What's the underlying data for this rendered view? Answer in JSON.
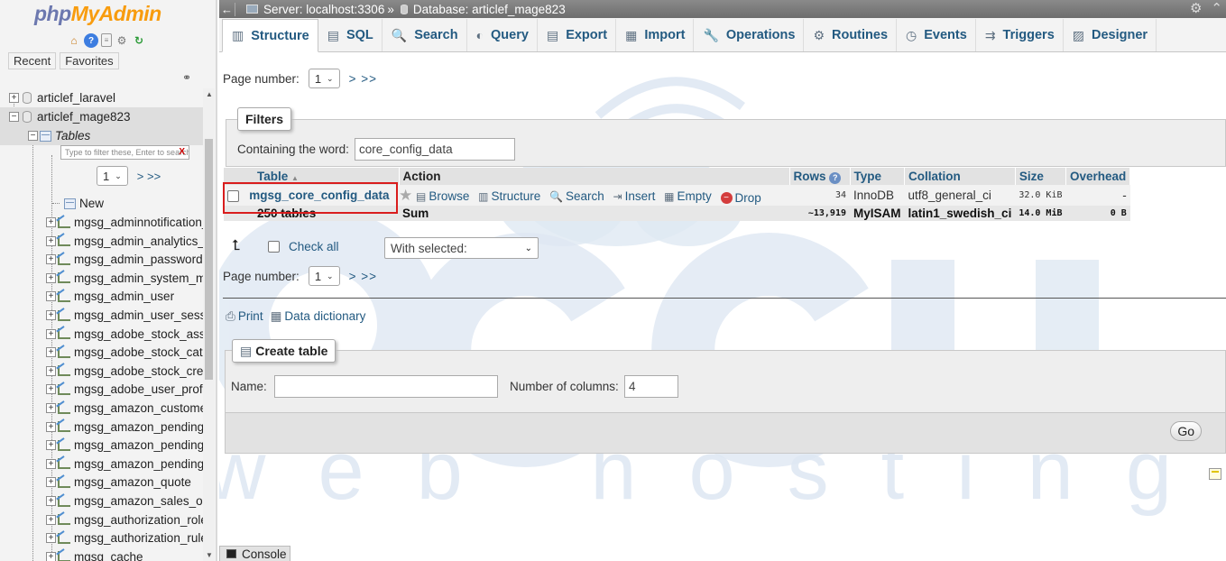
{
  "nav": {
    "logo_a": "php",
    "logo_b": "MyAdmin",
    "recent": "Recent",
    "favorites": "Favorites",
    "db1": "articlef_laravel",
    "db2": "articlef_mage823",
    "tables_label": "Tables",
    "filter_placeholder": "Type to filter these, Enter to search all",
    "filter_clear": "X",
    "page_value": "1",
    "page_next": "> >>",
    "new_label": "New",
    "tables": [
      "mgsg_adminnotification_inbox",
      "mgsg_admin_analytics_usage_version_log",
      "mgsg_admin_passwords",
      "mgsg_admin_system_messages",
      "mgsg_admin_user",
      "mgsg_admin_user_session",
      "mgsg_adobe_stock_asset",
      "mgsg_adobe_stock_category",
      "mgsg_adobe_stock_creator",
      "mgsg_adobe_user_profile",
      "mgsg_amazon_customer",
      "mgsg_amazon_pending_authorization",
      "mgsg_amazon_pending_capture",
      "mgsg_amazon_pending_refund",
      "mgsg_amazon_quote",
      "mgsg_amazon_sales_order",
      "mgsg_authorization_role",
      "mgsg_authorization_rule",
      "mgsg_cache"
    ]
  },
  "topbar": {
    "back": "←",
    "server": "Server: localhost:3306",
    "sep": "»",
    "database": "Database: articlef_mage823",
    "gear": "⚙",
    "collapse": "⌃"
  },
  "menu": {
    "tabs": [
      {
        "label": "Structure",
        "icon": "▥"
      },
      {
        "label": "SQL",
        "icon": "▤"
      },
      {
        "label": "Search",
        "icon": "🔍"
      },
      {
        "label": "Query",
        "icon": "◐"
      },
      {
        "label": "Export",
        "icon": "▤"
      },
      {
        "label": "Import",
        "icon": "▦"
      },
      {
        "label": "Operations",
        "icon": "🔧"
      },
      {
        "label": "Routines",
        "icon": "⚙"
      },
      {
        "label": "Events",
        "icon": "◷"
      },
      {
        "label": "Triggers",
        "icon": "⇉"
      },
      {
        "label": "Designer",
        "icon": "▨"
      }
    ]
  },
  "main": {
    "page_label": "Page number:",
    "page_value": "1",
    "page_next": "> >>",
    "filters_legend": "Filters",
    "containing_label": "Containing the word:",
    "containing_value": "core_config_data",
    "headers": {
      "table": "Table",
      "sort": "▲",
      "action": "Action",
      "rows": "Rows",
      "rows_help": "?",
      "type": "Type",
      "collation": "Collation",
      "size": "Size",
      "overhead": "Overhead"
    },
    "row": {
      "name": "mgsg_core_config_data",
      "browse": "Browse",
      "structure": "Structure",
      "search": "Search",
      "insert": "Insert",
      "empty": "Empty",
      "drop": "Drop",
      "rows": "34",
      "type": "InnoDB",
      "collation": "utf8_general_ci",
      "size": "32.0 KiB",
      "overhead": "-"
    },
    "sum": {
      "tables": "250 tables",
      "label": "Sum",
      "rows": "~13,919",
      "type": "MyISAM",
      "collation": "latin1_swedish_ci",
      "size": "14.0 MiB",
      "overhead": "0 B"
    },
    "check_all": "Check all",
    "with_selected": "With selected:",
    "print": "Print",
    "data_dictionary": "Data dictionary",
    "create_legend": "Create table",
    "name_label": "Name:",
    "name_value": "",
    "columns_label": "Number of columns:",
    "columns_value": "4",
    "go": "Go",
    "console": "Console"
  },
  "watermark": {
    "brand": "accu",
    "tagline": "web hosting",
    "color": "#dfe8f3"
  },
  "colors": {
    "link": "#235a81",
    "highlight_box": "#d91d1d",
    "logo_php": "#6c78af",
    "logo_admin": "#f89c0e"
  }
}
